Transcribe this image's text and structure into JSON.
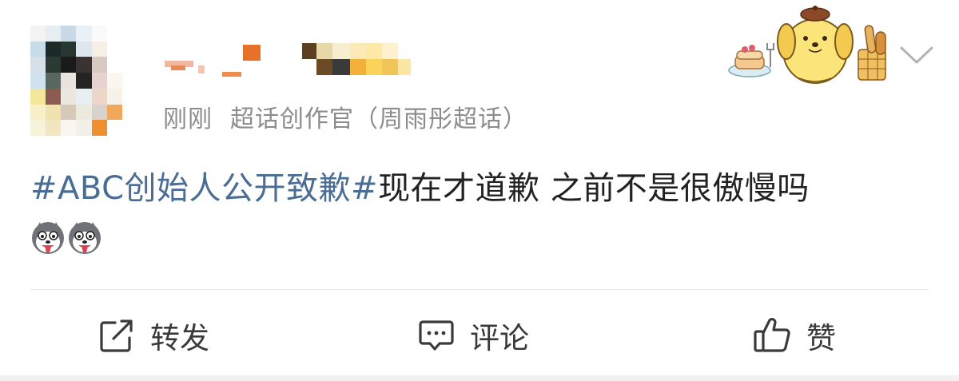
{
  "post": {
    "meta": {
      "time": "刚刚",
      "source": "超话创作官（周雨彤超话）"
    },
    "text": {
      "topic": "#ABC创始人公开致歉#",
      "body": "现在才道歉 之前不是很傲慢吗"
    },
    "emojis": [
      {
        "icon": "husky-dog-emoji"
      },
      {
        "icon": "husky-dog-emoji"
      }
    ]
  },
  "actions": {
    "repost": {
      "label": "转发",
      "icon": "repost-icon"
    },
    "comment": {
      "label": "评论",
      "icon": "comment-icon"
    },
    "like": {
      "label": "赞",
      "icon": "thumbs-up-icon"
    }
  },
  "colors": {
    "topic": "#4a6d96",
    "meta": "#8c8c8c",
    "text": "#222222",
    "action": "#3a3a3a"
  }
}
